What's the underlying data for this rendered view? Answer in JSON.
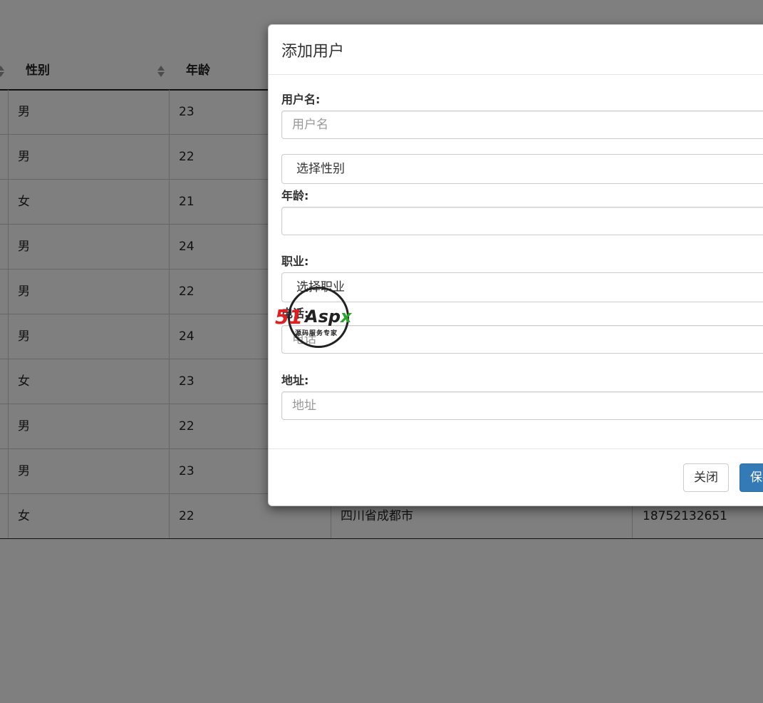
{
  "table": {
    "headers": {
      "gender": "性别",
      "age": "年龄"
    },
    "rows": [
      {
        "gender": "男",
        "age": "23"
      },
      {
        "gender": "男",
        "age": "22"
      },
      {
        "gender": "女",
        "age": "21"
      },
      {
        "gender": "男",
        "age": "24"
      },
      {
        "gender": "男",
        "age": "22"
      },
      {
        "gender": "男",
        "age": "24"
      },
      {
        "gender": "女",
        "age": "23"
      },
      {
        "gender": "男",
        "age": "22"
      },
      {
        "gender": "男",
        "age": "23"
      },
      {
        "gender": "女",
        "age": "22",
        "address": "四川省成都市",
        "phone": "18752132651"
      }
    ]
  },
  "modal": {
    "title": "添加用户",
    "username_label": "用户名:",
    "username_placeholder": "用户名",
    "gender_select": "选择性别",
    "age_label": "年龄:",
    "age_value": "",
    "job_label": "职业:",
    "job_select": "选择职业",
    "phone_label": "电话:",
    "phone_placeholder": "电话",
    "address_label": "地址:",
    "address_placeholder": "地址",
    "close_button": "关闭",
    "save_button": "保存"
  },
  "watermark": {
    "brand_number": "51",
    "brand_text": "Asp",
    "brand_x": "x",
    "subtitle": "源码服务专家"
  }
}
